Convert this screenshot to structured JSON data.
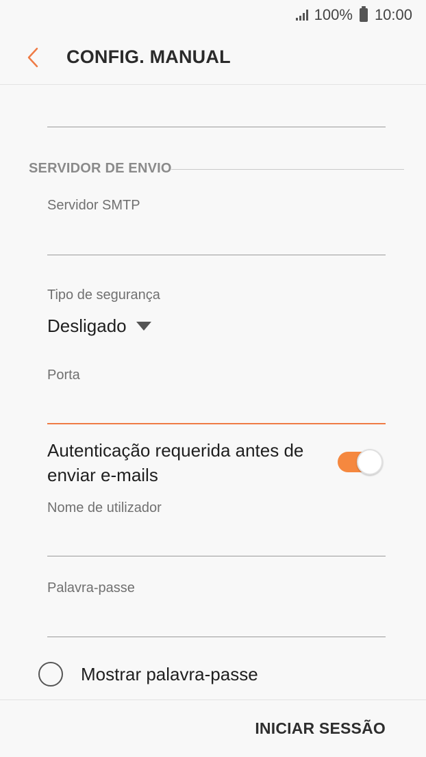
{
  "status_bar": {
    "battery": "100%",
    "time": "10:00",
    "icons": [
      "signal-icon",
      "battery-icon"
    ]
  },
  "app_bar": {
    "back_icon": "chevron-left-icon",
    "title": "CONFIG. MANUAL"
  },
  "section": {
    "title": "SERVIDOR DE ENVIO"
  },
  "fields": {
    "smtp_label": "Servidor SMTP",
    "smtp_value": "",
    "security_label": "Tipo de segurança",
    "security_value": "Desligado",
    "port_label": "Porta",
    "port_value": "",
    "auth_label": "Autenticação requerida antes de enviar e-mails",
    "auth_enabled": true,
    "username_label": "Nome de utilizador",
    "username_value": "",
    "password_label": "Palavra-passe",
    "password_value": "",
    "show_password_label": "Mostrar palavra-passe"
  },
  "footer": {
    "signin_label": "INICIAR SESSÃO"
  },
  "colors": {
    "accent": "#ef7b45",
    "toggle_on": "#f5883f",
    "background": "#f8f8f8"
  }
}
